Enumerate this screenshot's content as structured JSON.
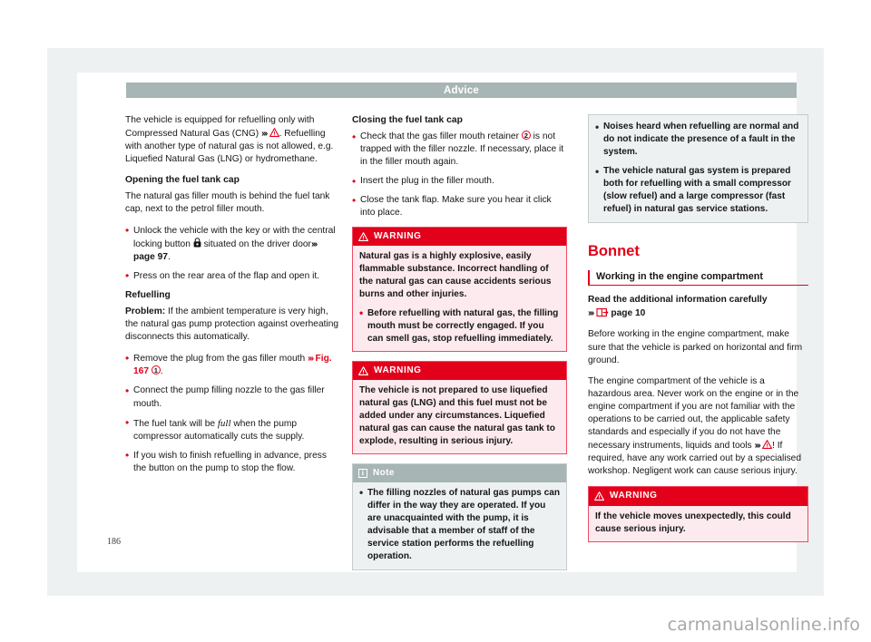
{
  "header": {
    "running_title": "Advice"
  },
  "folio": {
    "page_number": "186"
  },
  "watermark": {
    "text": "carmanualsonline.info"
  },
  "column_left": {
    "intro": {
      "part1": "The vehicle is equipped for refuelling only with Compressed Natural Gas (CNG)",
      "chevrons": "›››",
      "warn_icon": "warning-triangle-icon",
      "part2": ". Refuelling with another type of natural gas is not allowed, e.g. Liquefied Natural Gas (LNG) or hydromethane."
    },
    "heading_opening": "Opening the fuel tank cap",
    "opening_body": "The natural gas filler mouth is behind the fuel tank cap, next to the petrol filler mouth.",
    "bullet_unlock_a": "Unlock the vehicle with the key or with the central locking button",
    "lock_icon": "central-locking-lock-icon",
    "bullet_unlock_b": "situated on the driver door",
    "bullet_unlock_ref": "page 97",
    "bullet_unlock_end": ".",
    "bullet_press": "Press on the rear area of the flap and open it.",
    "heading_refuelling": "Refuelling",
    "problem_label": "Problem:",
    "problem_text": " If the ambient temperature is very high, the natural gas pump protection against overheating disconnects this automatically.",
    "bullet_remove_a": "Remove the plug from the gas filler mouth",
    "bullet_remove_fig": "Fig. 167",
    "bullet_remove_num": "1",
    "bullet_remove_end": ".",
    "bullet_connect": "Connect the pump filling nozzle to the gas filler mouth.",
    "bullet_full_a": "The fuel tank will be ",
    "bullet_full_em": "full",
    "bullet_full_b": " when the pump compressor automatically cuts the supply.",
    "bullet_finish": "If you wish to finish refuelling in advance, press the button on the pump to stop the flow."
  },
  "column_middle": {
    "heading_closing": "Closing the fuel tank cap",
    "bullet_check_a": "Check that the gas filler mouth retainer",
    "bullet_check_num": "2",
    "bullet_check_b": "is not trapped with the filler nozzle. If necessary, place it in the filler mouth again.",
    "bullet_insert": "Insert the plug in the filler mouth.",
    "bullet_close": "Close the tank flap. Make sure you hear it click into place.",
    "warning1": {
      "icon": "warning-triangle-icon",
      "title": "WARNING",
      "para": "Natural gas is a highly explosive, easily flammable substance. Incorrect handling of the natural gas can cause accidents serious burns and other injuries.",
      "bullet": "Before refuelling with natural gas, the filling mouth must be correctly engaged. If you can smell gas, stop refuelling immediately."
    },
    "warning2": {
      "icon": "warning-triangle-icon",
      "title": "WARNING",
      "para": "The vehicle is not prepared to use liquefied natural gas (LNG) and this fuel must not be added under any circumstances. Liquefied natural gas can cause the natural gas tank to explode, resulting in serious injury."
    },
    "note": {
      "icon": "info-icon",
      "icon_char": "i",
      "title": "Note",
      "bullet": "The filling nozzles of natural gas pumps can differ in the way they are operated. If you are unacquainted with the pump, it is advisable that a member of staff of the service station performs the refuelling operation."
    }
  },
  "column_right": {
    "note_continued": {
      "bullet1": "Noises heard when refuelling are normal and do not indicate the presence of a fault in the system.",
      "bullet2": "The vehicle natural gas system is prepared both for refuelling with a small compressor (slow refuel) and a large compressor (fast refuel) in natural gas service stations."
    },
    "chapter_title": "Bonnet",
    "section_title": "Working in the engine compartment",
    "lead_line1": "Read the additional information carefully",
    "lead_chevrons": "›››",
    "lead_icon": "manual-book-icon",
    "lead_page": "page 10",
    "para1": "Before working in the engine compartment, make sure that the vehicle is parked on horizontal and firm ground.",
    "para2_a": "The engine compartment of the vehicle is a hazardous area. Never work on the engine or in the engine compartment if you are not familiar with the operations to be carried out, the applicable safety standards and especially if you do not have the necessary instruments, liquids and tools",
    "para2_chevrons": "›››",
    "para2_icon": "warning-triangle-icon",
    "para2_b": "! If required, have any work carried out by a specialised workshop. Negligent work can cause serious injury.",
    "warning3": {
      "icon": "warning-triangle-icon",
      "title": "WARNING",
      "para": "If the vehicle moves unexpectedly, this could cause serious injury."
    }
  },
  "colors": {
    "accent_red": "#e2001a",
    "header_gray": "#a7b5b4",
    "warning_bg": "#fdeaee",
    "note_bg": "#eef1f2",
    "page_bg": "#eef1f2"
  }
}
